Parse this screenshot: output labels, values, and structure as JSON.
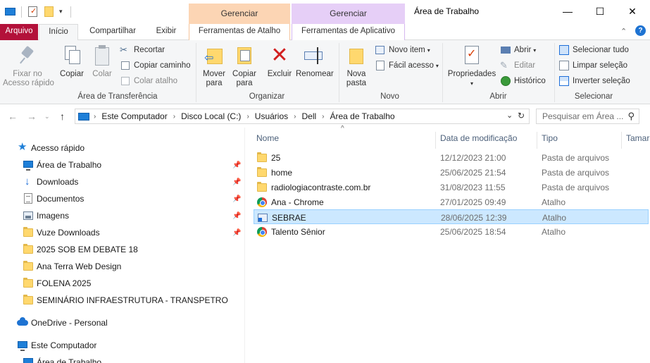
{
  "window": {
    "title": "Área de Trabalho",
    "minimize_glyph": "—",
    "maximize_glyph": "☐",
    "close_glyph": "✕"
  },
  "context_tabs": {
    "shortcut_header": "Gerenciar",
    "shortcut_tab": "Ferramentas de Atalho",
    "app_header": "Gerenciar",
    "app_tab": "Ferramentas de Aplicativo"
  },
  "tabs": {
    "arquivo": "Arquivo",
    "inicio": "Início",
    "compartilhar": "Compartilhar",
    "exibir": "Exibir"
  },
  "ribbon": {
    "clipboard": {
      "label": "Área de Transferência",
      "pin": "Fixar no\nAcesso rápido",
      "copy": "Copiar",
      "paste": "Colar",
      "cut": "Recortar",
      "copy_path": "Copiar caminho",
      "paste_shortcut": "Colar atalho"
    },
    "organize": {
      "label": "Organizar",
      "move": "Mover\npara",
      "copyto": "Copiar\npara",
      "delete": "Excluir",
      "rename": "Renomear"
    },
    "new": {
      "label": "Novo",
      "new_folder": "Nova\npasta",
      "new_item": "Novo item",
      "easy_access": "Fácil acesso"
    },
    "open": {
      "label": "Abrir",
      "properties": "Propriedades",
      "open": "Abrir",
      "edit": "Editar",
      "history": "Histórico"
    },
    "select": {
      "label": "Selecionar",
      "select_all": "Selecionar tudo",
      "clear": "Limpar seleção",
      "invert": "Inverter seleção"
    }
  },
  "address": {
    "crumbs": [
      "Este Computador",
      "Disco Local (C:)",
      "Usuários",
      "Dell",
      "Área de Trabalho"
    ],
    "search_placeholder": "Pesquisar em Área ..."
  },
  "nav_pane": {
    "quick_access": "Acesso rápido",
    "pinned": [
      "Área de Trabalho",
      "Downloads",
      "Documentos",
      "Imagens",
      "Vuze Downloads"
    ],
    "folders": [
      "2025 SOB EM DEBATE 18",
      "Ana Terra Web Design",
      "FOLENA 2025",
      "SEMINÁRIO INFRAESTRUTURA - TRANSPETRO"
    ],
    "onedrive": "OneDrive - Personal",
    "this_pc": "Este Computador",
    "desktop_sub": "Área de Trabalho"
  },
  "columns": {
    "name": "Nome",
    "date": "Data de modificação",
    "type": "Tipo",
    "size": "Tamar"
  },
  "files": [
    {
      "name": "25",
      "date": "12/12/2023 21:00",
      "type": "Pasta de arquivos",
      "icon": "folder-icon"
    },
    {
      "name": "home",
      "date": "25/06/2025 21:54",
      "type": "Pasta de arquivos",
      "icon": "folder-icon"
    },
    {
      "name": "radiologiacontraste.com.br",
      "date": "31/08/2023 11:55",
      "type": "Pasta de arquivos",
      "icon": "folder-icon"
    },
    {
      "name": "Ana - Chrome",
      "date": "27/01/2025 09:49",
      "type": "Atalho",
      "icon": "chrome-icon"
    },
    {
      "name": "SEBRAE",
      "date": "28/06/2025 12:39",
      "type": "Atalho",
      "icon": "shortcut-icon"
    },
    {
      "name": "Talento Sênior",
      "date": "25/06/2025 18:54",
      "type": "Atalho",
      "icon": "chrome-icon"
    }
  ],
  "selected_file_index": 4
}
